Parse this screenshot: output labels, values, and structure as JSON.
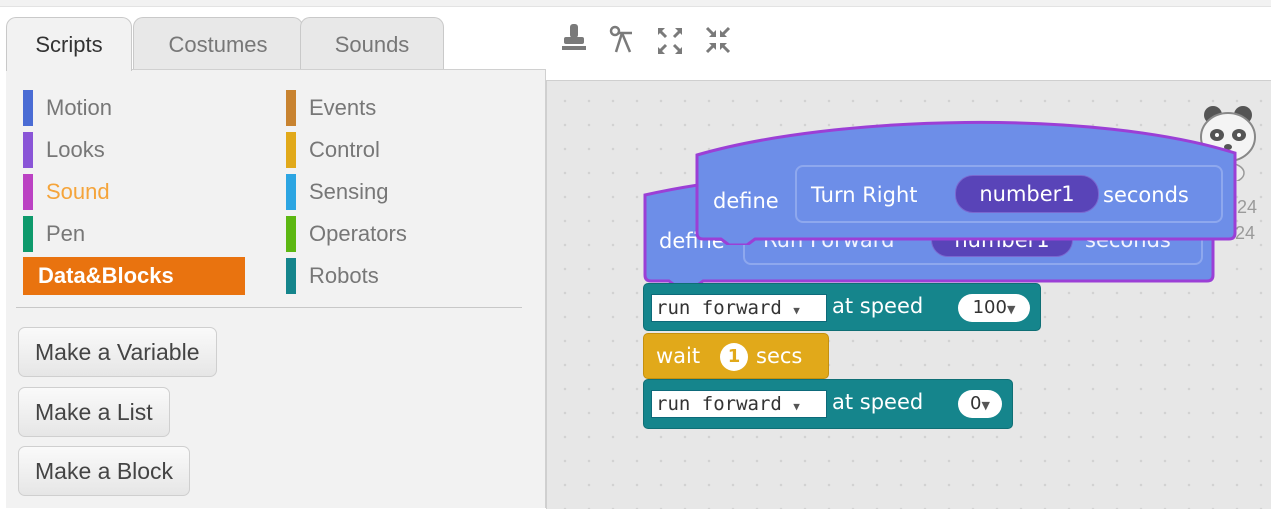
{
  "tabs": [
    {
      "label": "Scripts"
    },
    {
      "label": "Costumes"
    },
    {
      "label": "Sounds"
    }
  ],
  "categories": {
    "motion": {
      "label": "Motion",
      "color": "#4a6cd4"
    },
    "looks": {
      "label": "Looks",
      "color": "#8a55d7"
    },
    "sound": {
      "label": "Sound",
      "color": "#bb42c3"
    },
    "pen": {
      "label": "Pen",
      "color": "#0e9a6c"
    },
    "data_blocks": {
      "label": "Data&Blocks",
      "color": "#e9730f"
    },
    "events": {
      "label": "Events",
      "color": "#c88330"
    },
    "control": {
      "label": "Control",
      "color": "#e1a91a"
    },
    "sensing": {
      "label": "Sensing",
      "color": "#2ca5e2"
    },
    "operators": {
      "label": "Operators",
      "color": "#5cb712"
    },
    "robots": {
      "label": "Robots",
      "color": "#15858c"
    }
  },
  "palette_buttons": {
    "make_variable": "Make a Variable",
    "make_list": "Make a List",
    "make_block": "Make a Block"
  },
  "toolbar": {
    "icons": [
      "duplicate-stamp-icon",
      "delete-scissors-icon",
      "grow-icon",
      "shrink-icon"
    ]
  },
  "sprite_info": {
    "x_value": "24",
    "y_value": "-24"
  },
  "scripts": {
    "define_front": {
      "keyword": "define",
      "name": "Turn Right",
      "param": "number1",
      "suffix": "seconds"
    },
    "define_back": {
      "keyword": "define",
      "name_partial": "Run Forward",
      "param": "number1",
      "suffix": "seconds"
    },
    "run_forward_1": {
      "dropdown": "run forward",
      "text": "at speed",
      "value": "100"
    },
    "wait": {
      "keyword": "wait",
      "value": "1",
      "unit": "secs"
    },
    "run_forward_2": {
      "dropdown": "run forward",
      "text": "at speed",
      "value": "0"
    }
  },
  "colors": {
    "custom_block": "#6d8ee8",
    "robots_block": "#15858c",
    "control_block": "#e1a91a",
    "hat_border": "#9b3fd6",
    "param": "#5944b8"
  }
}
